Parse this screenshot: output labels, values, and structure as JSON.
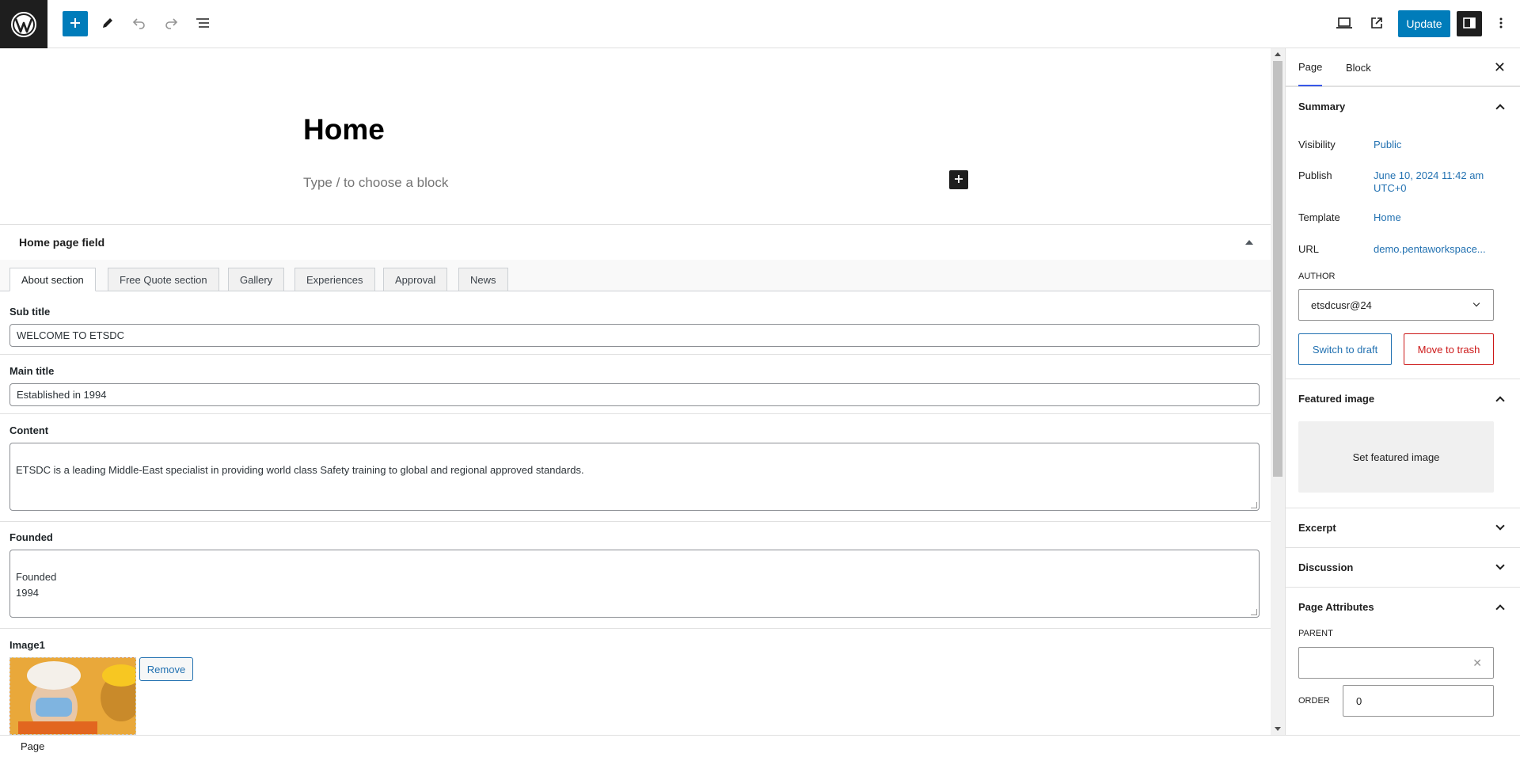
{
  "toolbar": {
    "update_label": "Update"
  },
  "editor": {
    "page_title": "Home",
    "block_placeholder": "Type / to choose a block"
  },
  "metabox": {
    "title": "Home page field",
    "tabs": [
      {
        "label": "About section"
      },
      {
        "label": "Free Quote section"
      },
      {
        "label": "Gallery"
      },
      {
        "label": "Experiences"
      },
      {
        "label": "Approval"
      },
      {
        "label": "News"
      }
    ],
    "fields": {
      "sub_title": {
        "label": "Sub title",
        "value": "WELCOME TO ETSDC"
      },
      "main_title": {
        "label": "Main title",
        "value": "Established in 1994"
      },
      "content": {
        "label": "Content",
        "value": "ETSDC is a leading Middle-East specialist in providing world class Safety training to global and regional approved standards."
      },
      "founded": {
        "label": "Founded",
        "value": "Founded\n1994"
      },
      "image1": {
        "label": "Image1",
        "remove_label": "Remove"
      }
    }
  },
  "footer": {
    "breadcrumb": "Page"
  },
  "sidebar": {
    "tabs": [
      {
        "label": "Page"
      },
      {
        "label": "Block"
      }
    ],
    "summary": {
      "title": "Summary",
      "visibility_label": "Visibility",
      "visibility_value": "Public",
      "publish_label": "Publish",
      "publish_value": "June 10, 2024 11:42 am UTC+0",
      "template_label": "Template",
      "template_value": "Home",
      "url_label": "URL",
      "url_value": "demo.pentaworkspace...",
      "author_label": "AUTHOR",
      "author_value": "etsdcusr@24",
      "switch_draft_label": "Switch to draft",
      "move_trash_label": "Move to trash"
    },
    "featured_image": {
      "title": "Featured image",
      "set_label": "Set featured image"
    },
    "excerpt": {
      "title": "Excerpt"
    },
    "discussion": {
      "title": "Discussion"
    },
    "page_attributes": {
      "title": "Page Attributes",
      "parent_label": "PARENT",
      "parent_value": "",
      "order_label": "ORDER",
      "order_value": "0"
    }
  },
  "colors": {
    "accent": "#007cba",
    "link": "#2271b1",
    "danger": "#cc1818",
    "dark": "#1e1e1e"
  }
}
